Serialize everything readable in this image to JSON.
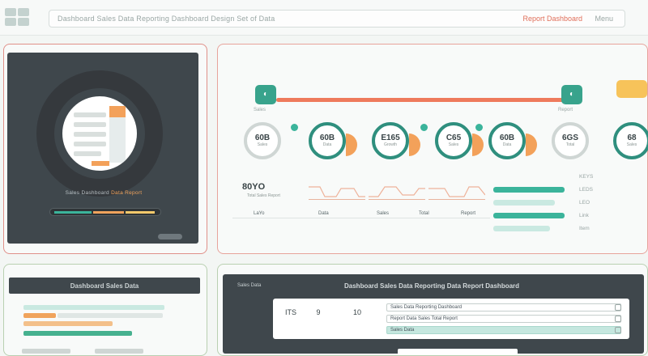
{
  "header": {
    "address": "Dashboard Sales Data Reporting Dashboard Design Set of Data",
    "right_link": "Report Dashboard",
    "right_more": "Menu"
  },
  "panel1": {
    "caption_prefix": "Sales Dashboard",
    "caption_accent": "Data Report",
    "progress_segments": [
      {
        "color": "#3bb49b",
        "fraction": 0.38
      },
      {
        "color": "#f0a35c",
        "fraction": 0.32
      },
      {
        "color": "#f5c96b",
        "fraction": 0.3
      }
    ]
  },
  "panel2": {
    "slider_label_left": "Sales",
    "slider_label_right": "Report",
    "dials": [
      {
        "value": "60B",
        "sub": "Sales"
      },
      {
        "value": "60B",
        "sub": "Data"
      },
      {
        "value": "E165",
        "sub": "Growth"
      },
      {
        "value": "C65",
        "sub": "Sales"
      },
      {
        "value": "60B",
        "sub": "Data"
      },
      {
        "value": "6GS",
        "sub": "Total"
      },
      {
        "value": "68",
        "sub": "Sales"
      }
    ],
    "metric": "80YO",
    "metric_sub": "Total Sales Report",
    "tabs": [
      "LaYo",
      "Data",
      "Sales",
      "Total",
      "Report"
    ],
    "right_rows": [
      "KEYS",
      "LEDS",
      "LEO",
      "Link",
      "Item"
    ]
  },
  "panel3": {
    "title": "Dashboard Sales Data"
  },
  "panel4": {
    "title_left": "Sales Data",
    "title": "Dashboard Sales Data Reporting Data Report Dashboard",
    "icons": [
      "ITS",
      "9",
      "10"
    ],
    "inputs": [
      "Sales Data Reporting Dashboard",
      "Report Data Sales Total Report",
      "Sales Data"
    ]
  }
}
